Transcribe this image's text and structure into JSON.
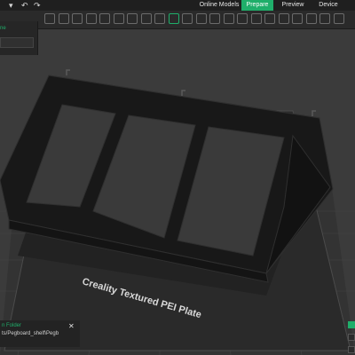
{
  "topbar": {
    "icons": [
      "dropdown-icon",
      "undo-icon",
      "redo-icon"
    ],
    "tabs": [
      {
        "label": "Online Models",
        "active": false
      },
      {
        "label": "Prepare",
        "active": true
      },
      {
        "label": "Preview",
        "active": false
      },
      {
        "label": "Device",
        "active": false
      }
    ]
  },
  "toolbar": {
    "tools": [
      "add-icon",
      "delete-icon",
      "grid-icon",
      "orient-icon",
      "arrange-icon",
      "lay-flat-icon",
      "variable-layer-icon",
      "split-icon",
      "move-icon",
      "rotate-icon",
      "scale-icon",
      "place-face-icon",
      "cut-icon",
      "support-paint-icon",
      "seam-paint-icon",
      "color-paint-icon",
      "measure-icon",
      "assembly-icon",
      "text-icon",
      "view-icon",
      "slice-icon",
      "settings-icon"
    ]
  },
  "panel": {
    "row1_label": "ne"
  },
  "plate": {
    "label": "Creality Textured PEI Plate"
  },
  "notification": {
    "title": "n Folder",
    "path": "ts/Pegboard_shelf\\Pegb",
    "close": "✕"
  },
  "colors": {
    "accent": "#1fae6a",
    "background": "#3b3b3b",
    "plate": "#2c2c2c",
    "model": "#1a1a1a"
  }
}
